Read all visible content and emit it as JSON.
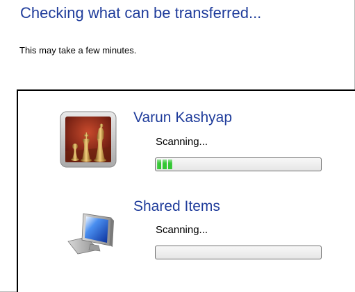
{
  "header": {
    "title": "Checking what can be transferred...",
    "subtitle": "This may take a few minutes."
  },
  "entries": [
    {
      "name": "Varun Kashyap",
      "status": "Scanning...",
      "icon": "chess-user-picture",
      "progress": 0.1
    },
    {
      "name": "Shared Items",
      "status": "Scanning...",
      "icon": "computer-monitor-icon",
      "progress": 0
    }
  ],
  "colors": {
    "title": "#1f3c9b",
    "progress_fill": "#33c733",
    "panel_border": "#000000"
  }
}
